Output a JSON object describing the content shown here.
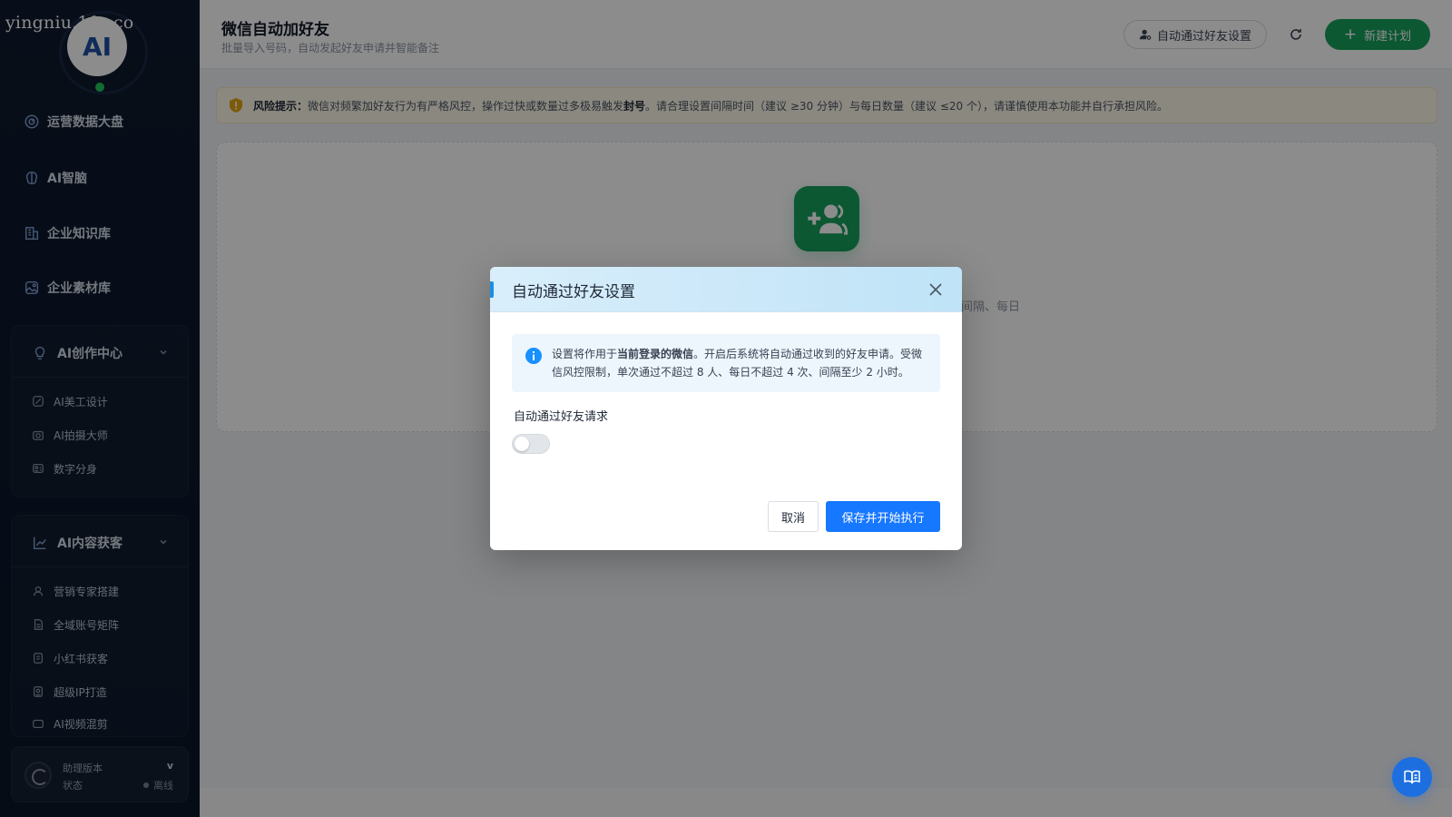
{
  "watermark": "yingniu.10v.co",
  "logo": {
    "text": "AI"
  },
  "sidebar": {
    "items": [
      {
        "label": "运营数据大盘",
        "icon": "dashboard-icon"
      },
      {
        "label": "AI智脑",
        "icon": "brain-icon"
      },
      {
        "label": "企业知识库",
        "icon": "building-icon"
      },
      {
        "label": "企业素材库",
        "icon": "image-icon"
      }
    ],
    "groups": [
      {
        "label": "AI创作中心",
        "icon": "bulb-icon",
        "items": [
          {
            "label": "AI美工设计",
            "icon": "palette-icon"
          },
          {
            "label": "AI拍摄大师",
            "icon": "camera-icon"
          },
          {
            "label": "数字分身",
            "icon": "id-card-icon"
          }
        ]
      },
      {
        "label": "AI内容获客",
        "icon": "trend-icon",
        "items": [
          {
            "label": "营销专家搭建",
            "icon": "user-icon"
          },
          {
            "label": "全域账号矩阵",
            "icon": "file-icon"
          },
          {
            "label": "小红书获客",
            "icon": "note-icon"
          },
          {
            "label": "超级IP打造",
            "icon": "badge-icon"
          },
          {
            "label": "AI视频混剪",
            "icon": "video-icon"
          }
        ]
      }
    ],
    "status": {
      "version_label": "助理版本",
      "version_value": "v",
      "state_label": "状态",
      "state_value": "离线"
    }
  },
  "header": {
    "title": "微信自动加好友",
    "subtitle": "批量导入号码，自动发起好友申请并智能备注",
    "settings_button": "自动通过好友设置",
    "new_plan_button": "新建计划"
  },
  "warning": {
    "label": "风险提示：",
    "text_a": "微信对频繁加好友行为有严格风控，操作过快或数量过多极易触发",
    "text_bold": "封号",
    "text_b": "。请合理设置间隔时间（建议 ≥30 分钟）与每日数量（建议 ≤20 个），请谨慎使用本功能并自行承担风险。"
  },
  "empty": {
    "hint_tail": "间隔、每日"
  },
  "modal": {
    "title": "自动通过好友设置",
    "info_a": "设置将作用于",
    "info_bold": "当前登录的微信",
    "info_b": "。开启后系统将自动通过收到的好友申请。受微信风控限制，单次通过不超过 8 人、每日不超过 4 次、间隔至少 2 小时。",
    "toggle_label": "自动通过好友请求",
    "toggle_on": false,
    "cancel": "取消",
    "save": "保存并开始执行"
  },
  "colors": {
    "accent": "#1677ff",
    "brand_green": "#17a05d",
    "sidebar_bg": "#0f1a2e",
    "warning_bg": "#fdf8e9"
  }
}
